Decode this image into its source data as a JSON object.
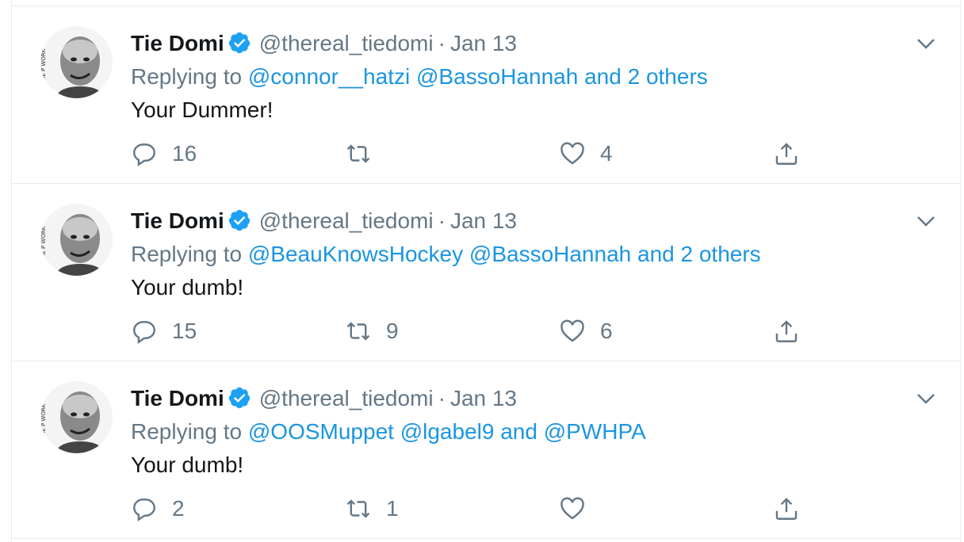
{
  "colors": {
    "link": "#1b95e0",
    "muted": "#657786",
    "text": "#14171a",
    "verified": "#1da1f2",
    "border": "#e6ecf0"
  },
  "icons": {
    "reply": "speech-bubble-icon",
    "retweet": "retweet-arrows-icon",
    "like": "heart-icon",
    "share": "share-upload-icon",
    "menu": "chevron-down-icon",
    "verified": "verified-badge-icon"
  },
  "tweets": [
    {
      "name": "Tie Domi",
      "handle": "@thereal_tiedomi",
      "separator": "·",
      "date": "Jan 13",
      "replying_prefix": "Replying to",
      "mention1": "@connor__hatzi",
      "mention2": "@BassoHannah",
      "joiner": "and",
      "mention3": "2 others",
      "text": "Your Dummer!",
      "replies": "16",
      "retweets": "",
      "likes": "4"
    },
    {
      "name": "Tie Domi",
      "handle": "@thereal_tiedomi",
      "separator": "·",
      "date": "Jan 13",
      "replying_prefix": "Replying to",
      "mention1": "@BeauKnowsHockey",
      "mention2": "@BassoHannah",
      "joiner": "and",
      "mention3": "2 others",
      "text": "Your dumb!",
      "replies": "15",
      "retweets": "9",
      "likes": "6"
    },
    {
      "name": "Tie Domi",
      "handle": "@thereal_tiedomi",
      "separator": "·",
      "date": "Jan 13",
      "replying_prefix": "Replying to",
      "mention1": "@OOSMuppet",
      "mention2": "@lgabel9",
      "joiner": "and",
      "mention3": "@PWHPA",
      "text": "Your dumb!",
      "replies": "2",
      "retweets": "1",
      "likes": ""
    }
  ]
}
